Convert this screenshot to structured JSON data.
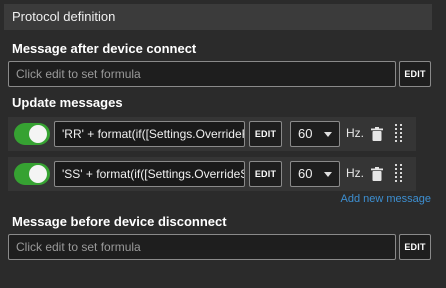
{
  "header": {
    "title": "Protocol definition"
  },
  "connect": {
    "label": "Message after device connect",
    "placeholder": "Click edit to set formula",
    "edit_label": "EDIT"
  },
  "update": {
    "label": "Update messages",
    "rows": [
      {
        "enabled": true,
        "formula": "'RR' + format(if([Settings.OverrideR",
        "edit_label": "EDIT",
        "rate": "60",
        "unit": "Hz."
      },
      {
        "enabled": true,
        "formula": "'SS' + format(if([Settings.OverrideS",
        "edit_label": "EDIT",
        "rate": "60",
        "unit": "Hz."
      }
    ],
    "add_label": "Add new message"
  },
  "disconnect": {
    "label": "Message before device disconnect",
    "placeholder": "Click edit to set formula",
    "edit_label": "EDIT"
  },
  "colors": {
    "toggle_on": "#36a232",
    "link": "#3d8fd1",
    "panel_bg": "#2b2b2b",
    "header_bg": "#3b3b3b"
  },
  "icons": {
    "row_delete": "trash-icon",
    "row_drag": "drag-handle-icon",
    "dropdown": "chevron-down-icon"
  }
}
